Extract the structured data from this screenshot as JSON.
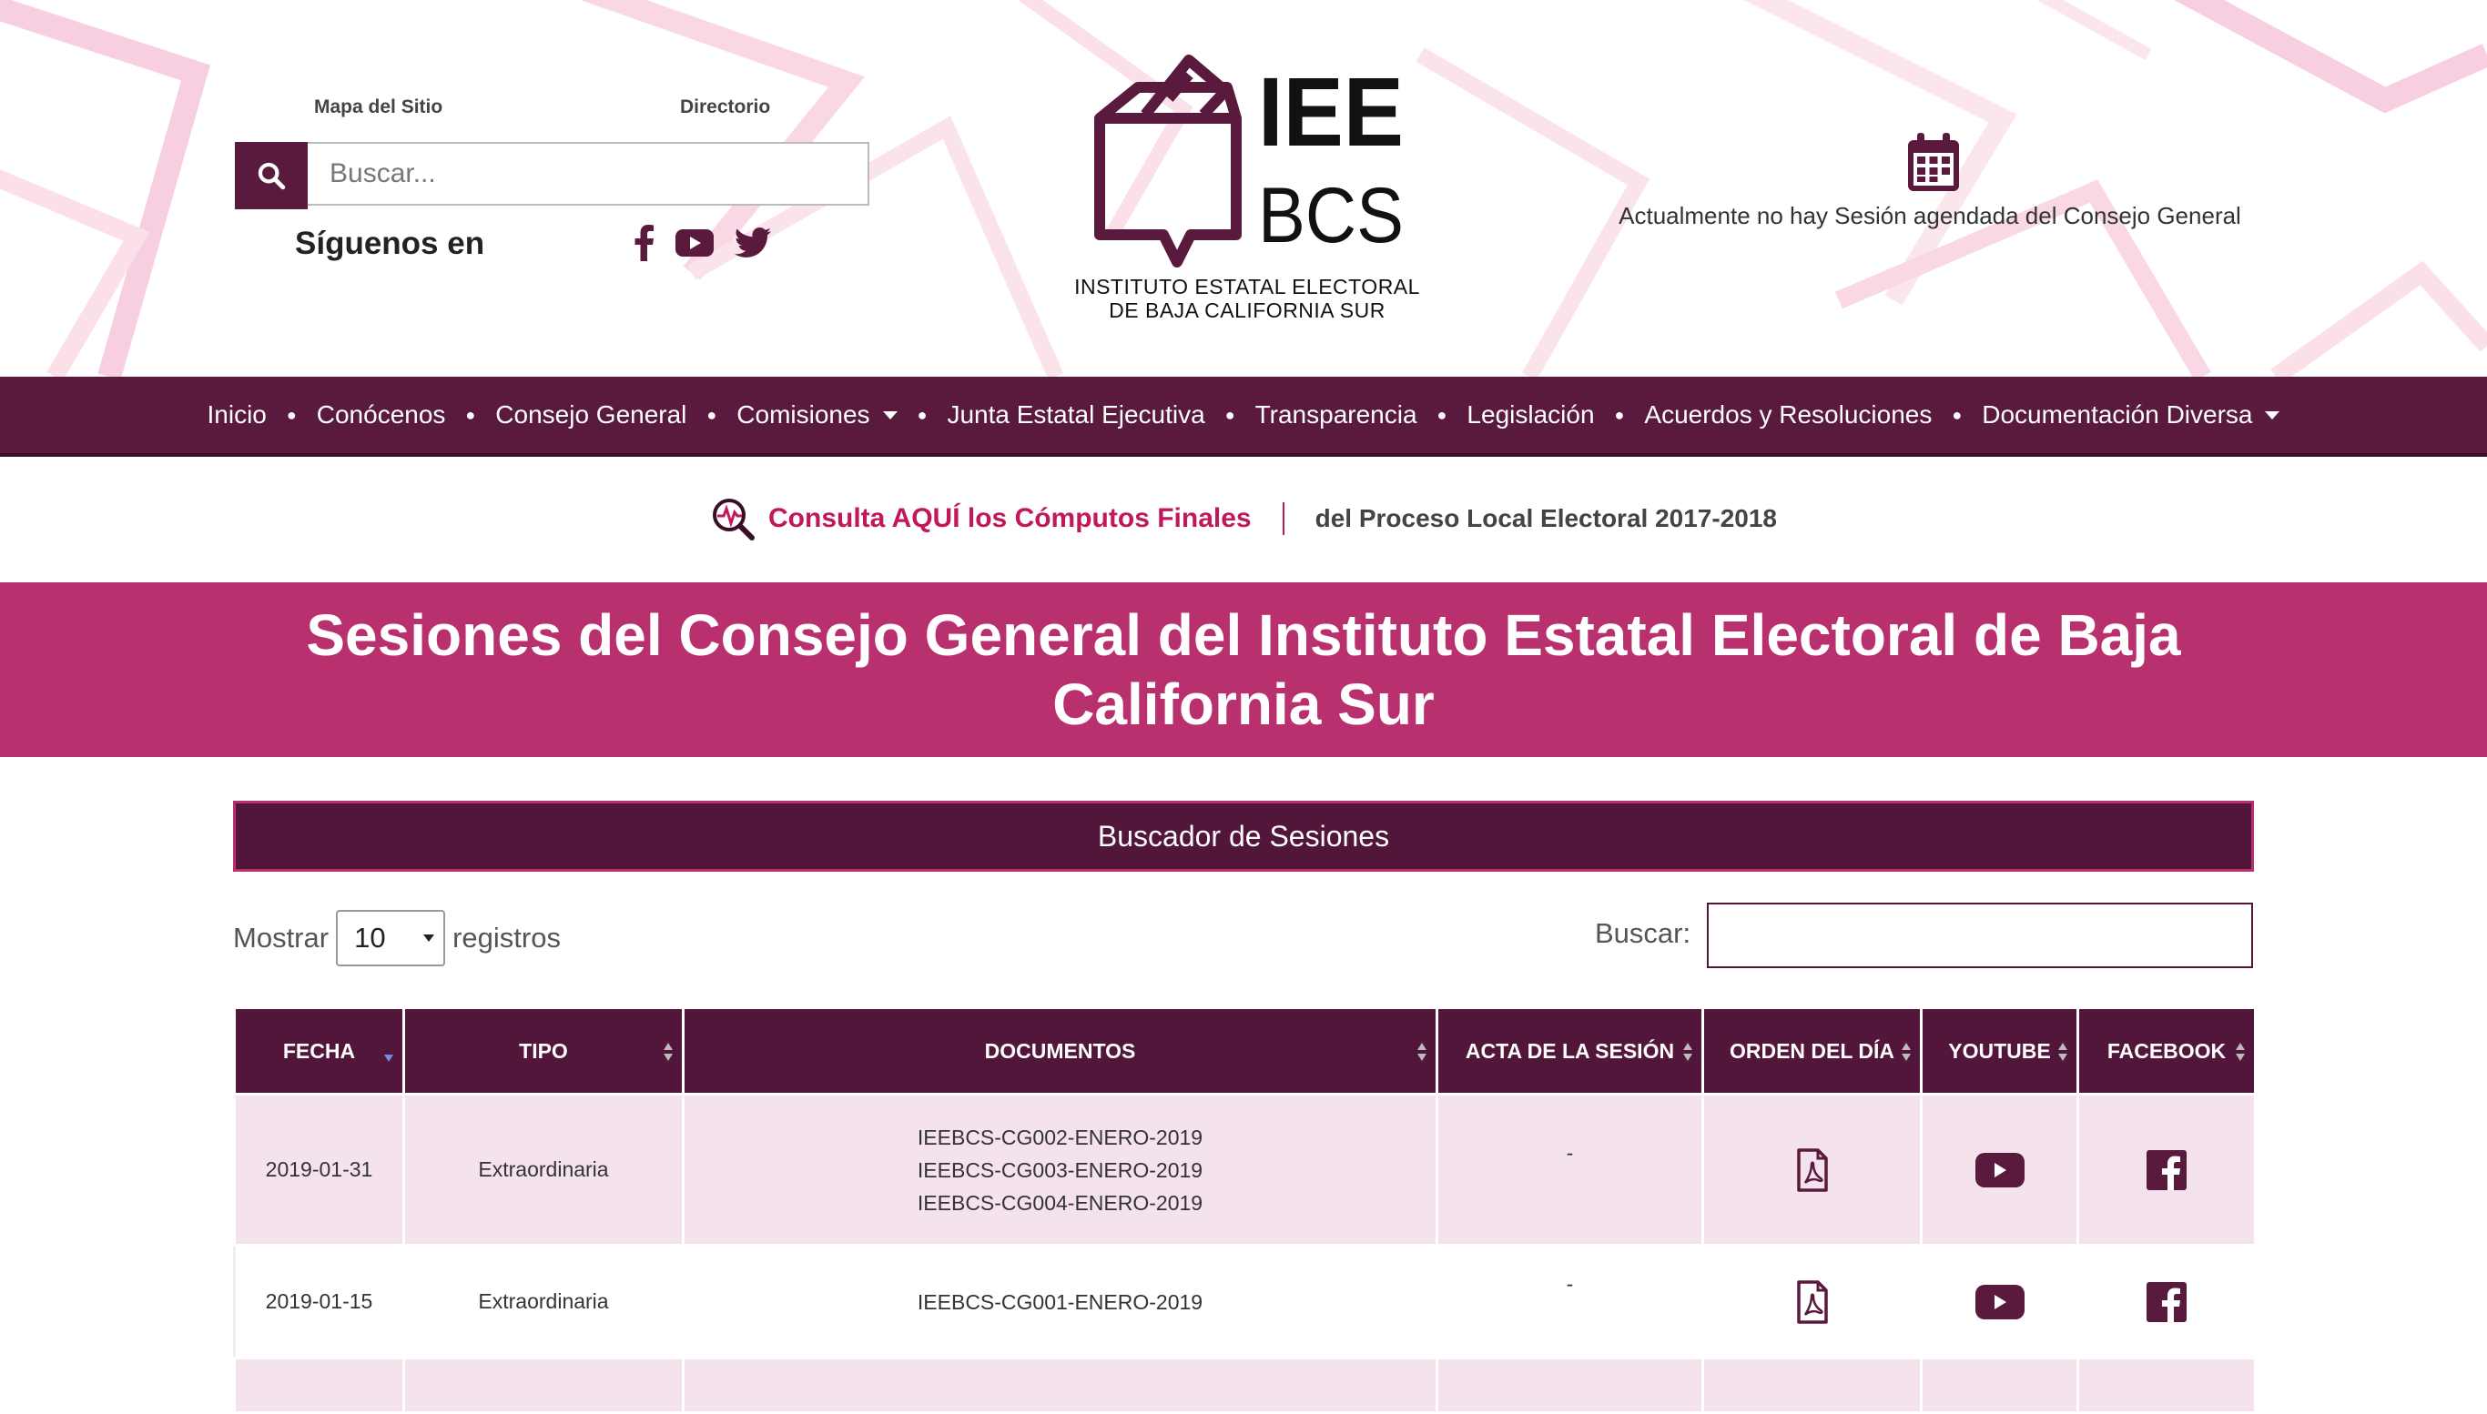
{
  "header": {
    "links": {
      "sitemap": "Mapa del Sitio",
      "directory": "Directorio"
    },
    "search": {
      "placeholder": "Buscar..."
    },
    "follow_label": "Síguenos en",
    "social": [
      "facebook-icon",
      "youtube-icon",
      "twitter-icon"
    ],
    "logo": {
      "mark_top": "IEE",
      "mark_bottom": "BCS",
      "line1": "INSTITUTO ESTATAL ELECTORAL",
      "line2": "DE BAJA CALIFORNIA SUR"
    },
    "calendar_text": "Actualmente no hay Sesión agendada del Consejo General"
  },
  "nav": {
    "items": [
      {
        "label": "Inicio"
      },
      {
        "label": "Conócenos"
      },
      {
        "label": "Consejo General"
      },
      {
        "label": "Comisiones"
      },
      {
        "label": "Junta Estatal Ejecutiva"
      },
      {
        "label": "Transparencia"
      },
      {
        "label": "Legislación"
      },
      {
        "label": "Acuerdos y Resoluciones"
      },
      {
        "label": "Documentación Diversa"
      }
    ]
  },
  "consulta": {
    "link": "Consulta AQUÍ los Cómputos Finales",
    "rest": "del Proceso Local Electoral 2017-2018"
  },
  "page_title": "Sesiones del Consejo General del Instituto Estatal Electoral de Baja California Sur",
  "buscador_title": "Buscador de Sesiones",
  "controls": {
    "show_label": "Mostrar",
    "show_value": "10",
    "records_label": "registros",
    "search_label": "Buscar:"
  },
  "table": {
    "headers": {
      "fecha": "FECHA",
      "tipo": "TIPO",
      "documentos": "DOCUMENTOS",
      "acta": "ACTA DE LA SESIÓN",
      "orden": "ORDEN DEL DÍA",
      "youtube": "YOUTUBE",
      "facebook": "FACEBOOK"
    },
    "rows": [
      {
        "fecha": "2019-01-31",
        "tipo": "Extraordinaria",
        "docs": [
          "IEEBCS-CG002-ENERO-2019",
          "IEEBCS-CG003-ENERO-2019",
          "IEEBCS-CG004-ENERO-2019"
        ],
        "acta": "-"
      },
      {
        "fecha": "2019-01-15",
        "tipo": "Extraordinaria",
        "docs": [
          "IEEBCS-CG001-ENERO-2019"
        ],
        "acta": "-"
      }
    ]
  },
  "colors": {
    "brand_dark": "#5a1a3d",
    "brand_pink": "#b9306e",
    "accent": "#c2185b",
    "row_tint": "#f4e3ec"
  }
}
